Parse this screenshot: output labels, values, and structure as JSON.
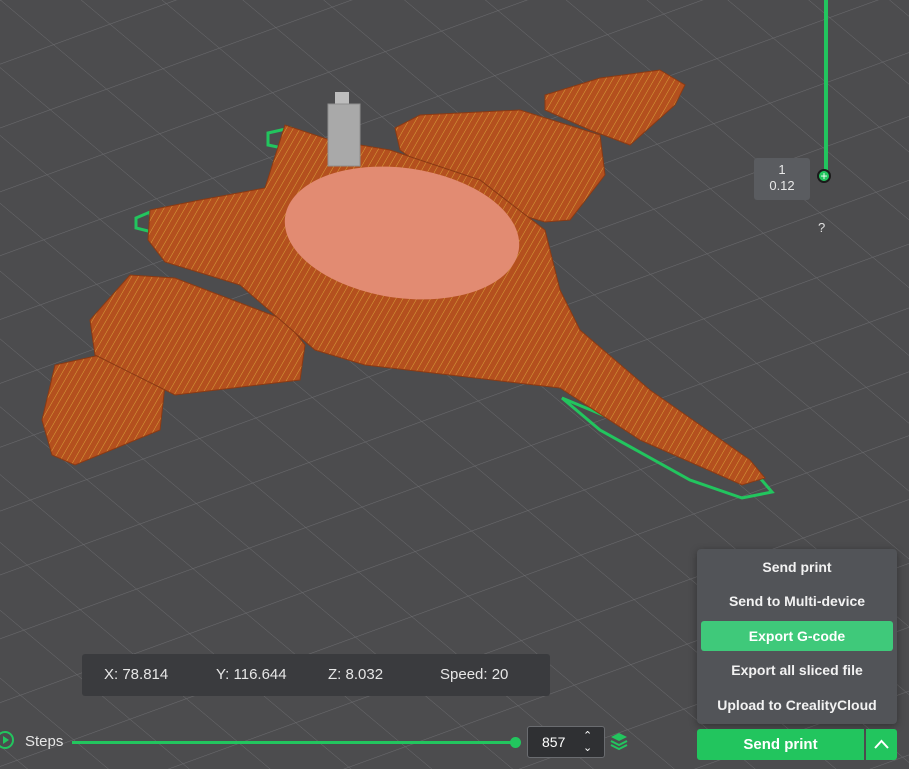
{
  "layer_panel": {
    "layer_number": "1",
    "layer_height": "0.12",
    "help_glyph": "?"
  },
  "coordinates": {
    "x": "X: 78.814",
    "y": "Y: 116.644",
    "z": "Z: 8.032",
    "speed": "Speed: 20"
  },
  "send_menu": {
    "items": [
      {
        "label": "Send print"
      },
      {
        "label": "Send to Multi-device"
      },
      {
        "label": "Export G-code"
      },
      {
        "label": "Export all sliced file"
      },
      {
        "label": "Upload to CrealityCloud"
      }
    ],
    "highlighted_item": "Export G-code"
  },
  "bottom_bar": {
    "steps_label": "Steps",
    "step_value": "857",
    "steps_progress": 1.0,
    "send_print_label": "Send print"
  },
  "colors": {
    "accent": "#22c55e",
    "model": "#b4501e",
    "background": "#4c4c4e"
  },
  "icons": [
    "play-icon",
    "chevron-up-icon",
    "chevron-down-icon",
    "layers-icon",
    "help-icon",
    "nozzle-icon"
  ]
}
